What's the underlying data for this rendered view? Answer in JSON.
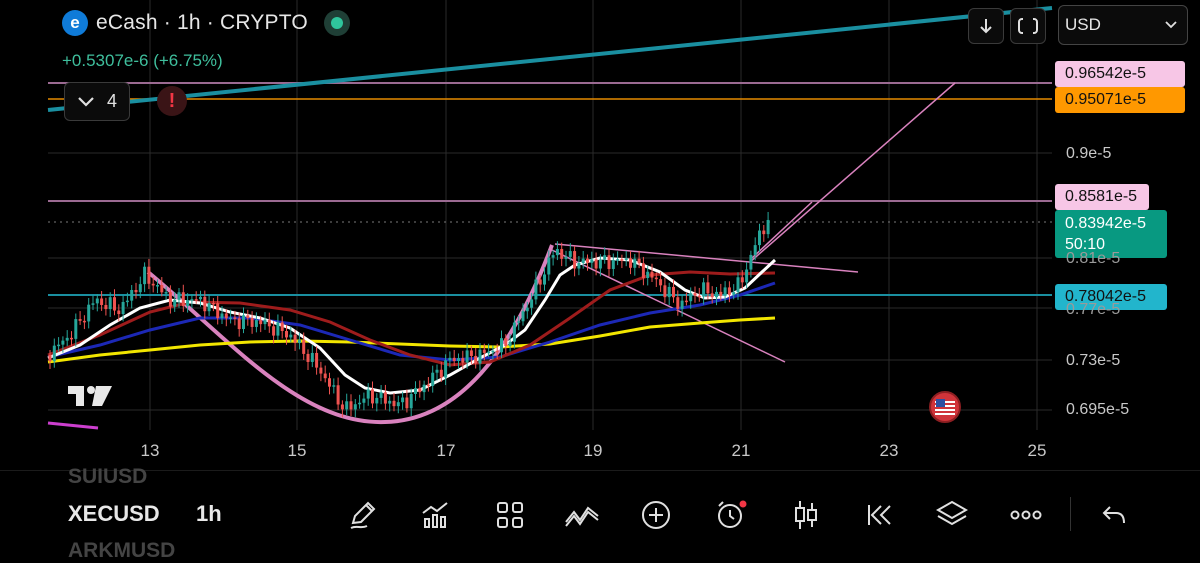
{
  "header": {
    "logo_letter": "e",
    "title": "eCash · 1h · CRYPTO",
    "change": "+0.5307e-6 (+6.75%)",
    "indicator_count": "4",
    "alert_symbol": "!"
  },
  "currency": {
    "selected": "USD"
  },
  "price_axis": {
    "ticks": [
      "0.9e-5",
      "0.81e-5",
      "0.77e-5",
      "0.73e-5",
      "0.695e-5"
    ],
    "labels": [
      {
        "text": "0.96542e-5",
        "bg": "#f7c6e6",
        "fg": "#111111"
      },
      {
        "text": "0.95071e-5",
        "bg": "#ff9800",
        "fg": "#111111"
      },
      {
        "text": "0.8581e-5",
        "bg": "#f7c6e6",
        "fg": "#111111"
      },
      {
        "text": "0.83942e-5",
        "bg": "#089981",
        "fg": "#ffffff"
      },
      {
        "text": "50:10",
        "bg": "#089981",
        "fg": "#ffffff"
      },
      {
        "text": "0.78042e-5",
        "bg": "#22b5cc",
        "fg": "#111111"
      }
    ]
  },
  "time_axis": {
    "ticks": [
      "13",
      "15",
      "17",
      "19",
      "21",
      "23",
      "25"
    ]
  },
  "watermark": "TV",
  "toolbar": {
    "prev_symbol": "SUIUSD",
    "symbol": "XECUSD",
    "timeframe": "1h",
    "next_symbol": "ARKMUSD",
    "tools": [
      "pencil-icon",
      "indicators-icon",
      "grid-icon",
      "trend-icon",
      "plus-circle-icon",
      "alarm-icon",
      "candles-icon",
      "replay-icon",
      "layers-icon",
      "more-icon",
      "undo-icon"
    ]
  },
  "colors": {
    "up": "#26a69a",
    "down": "#ef5350",
    "accent_teal": "#1a8fa0",
    "pink_line": "#d982be",
    "orange_line": "#ff9800"
  }
}
